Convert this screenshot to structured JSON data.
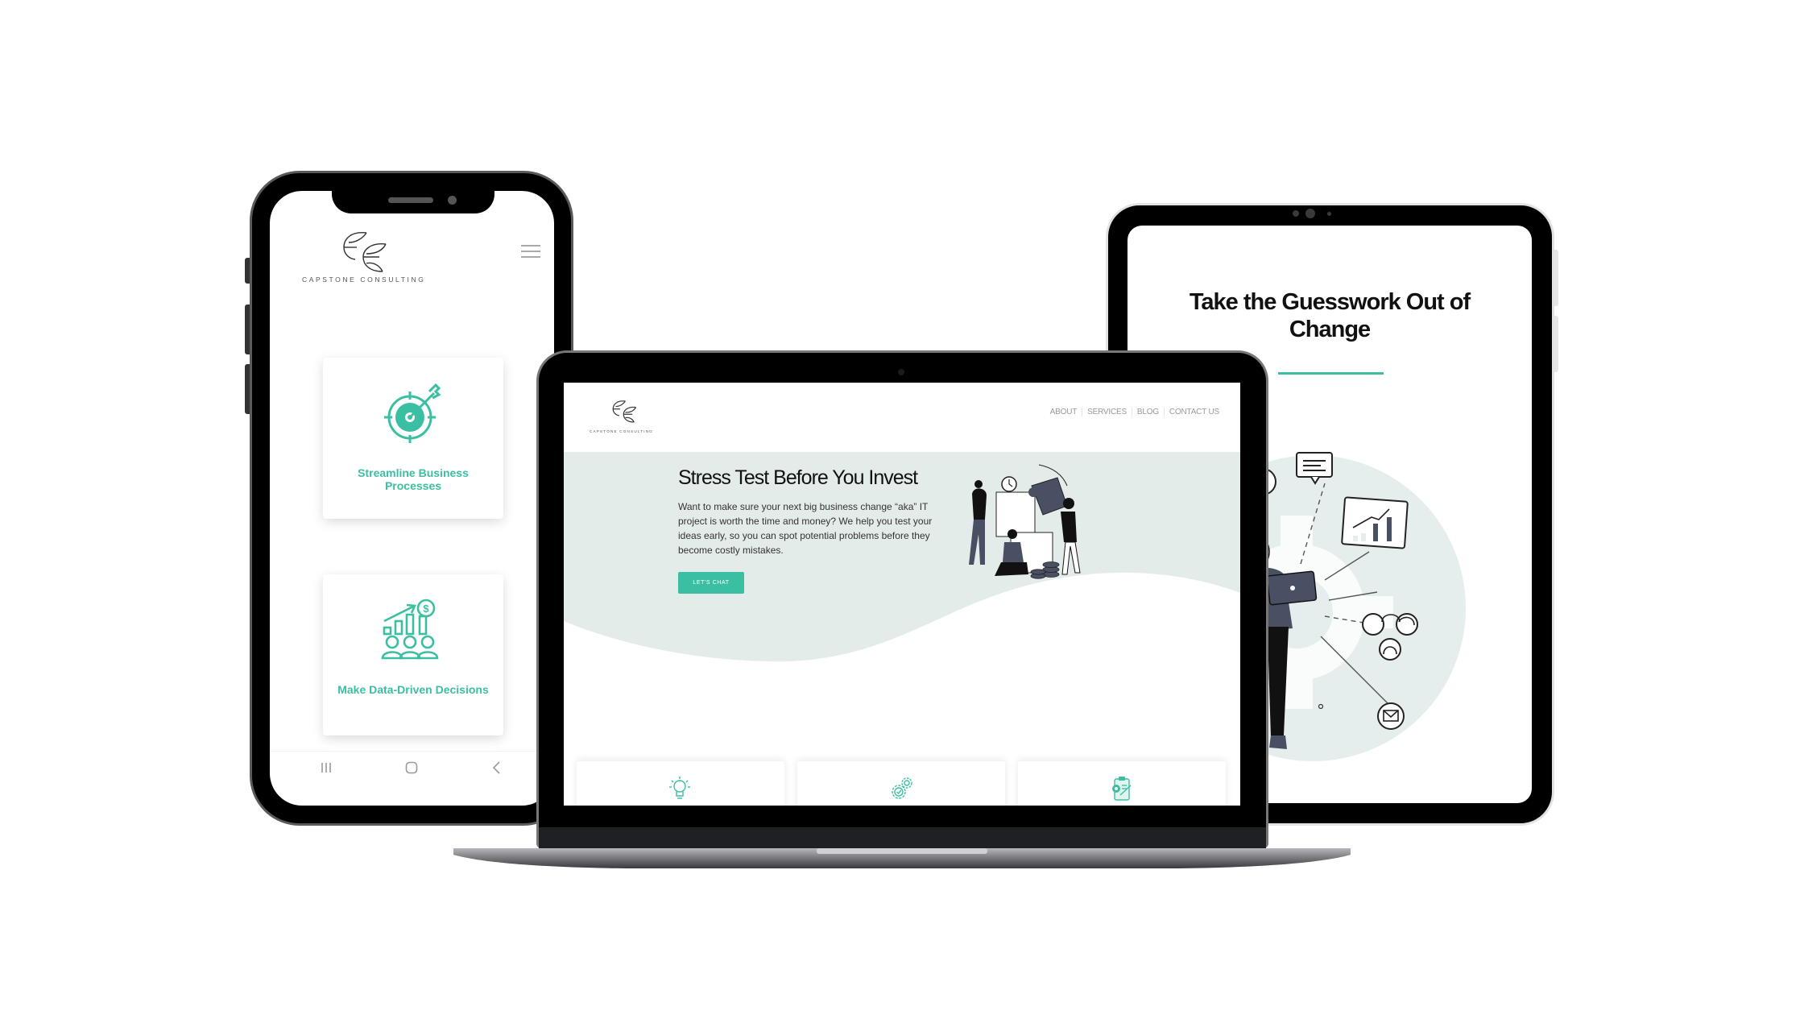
{
  "brand": {
    "name": "CAPSTONE CONSULTING",
    "accent_color": "#3bbfa3",
    "hero_bg_color": "#e4ecea"
  },
  "phone": {
    "menu_icon": "hamburger-icon",
    "cards": [
      {
        "icon": "target-arrow-icon",
        "label": "Streamline Business Processes"
      },
      {
        "icon": "growth-chart-people-icon",
        "label": "Make Data-Driven Decisions"
      }
    ],
    "nav_bar": [
      {
        "icon": "recent-apps-icon",
        "glyph": "|||"
      },
      {
        "icon": "home-icon",
        "glyph": ""
      },
      {
        "icon": "back-icon",
        "glyph": "‹"
      }
    ]
  },
  "laptop": {
    "nav": [
      "ABOUT",
      "SERVICES",
      "BLOG",
      "CONTACT US"
    ],
    "hero": {
      "title": "Stress Test Before You Invest",
      "body": "Want to make sure your next big business change “aka” IT project is worth the time and money? We help you test your ideas early, so you can spot potential problems before they become costly mistakes.",
      "cta": "LET'S CHAT"
    },
    "cards": [
      {
        "icon": "lightbulb-icon"
      },
      {
        "icon": "gears-check-icon"
      },
      {
        "icon": "clipboard-gear-icon"
      }
    ]
  },
  "tablet": {
    "title": "Take the Guesswork Out of Change"
  }
}
